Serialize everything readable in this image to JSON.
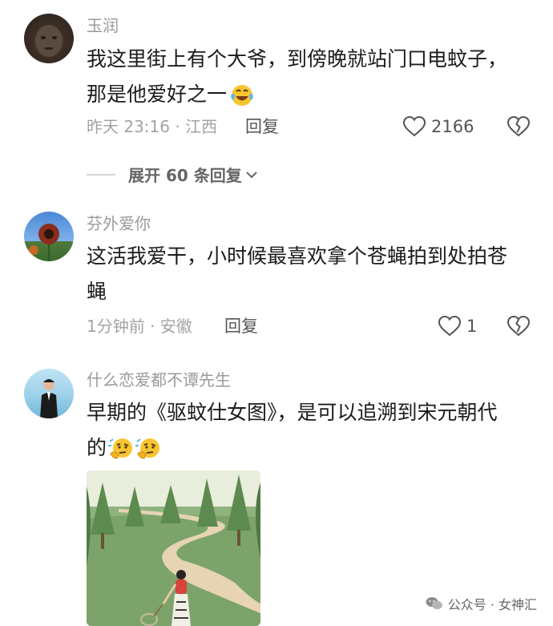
{
  "comments": [
    {
      "username": "玉润",
      "lines": [
        "我这里街上有个大爷，到傍晚就站门口电蚊子，",
        "那是他爱好之一"
      ],
      "time_location": "昨天 23:16 · 江西",
      "reply_label": "回复",
      "likes": "2166",
      "expand_label": "展开 60 条回复"
    },
    {
      "username": "芬外爱你",
      "lines": [
        "这活我爱干，小时候最喜欢拿个苍蝇拍到处拍苍",
        "蝇"
      ],
      "time_location": "1分钟前 · 安徽",
      "reply_label": "回复",
      "likes": "1"
    },
    {
      "username": "什么恋爱都不谭先生",
      "lines": [
        "早期的《驱蚊仕女图》，是可以追溯到宋元朝代",
        "的"
      ]
    }
  ],
  "watermark": {
    "text": "公众号 · 女神汇"
  },
  "icons": {
    "like": "heart-outline-icon",
    "dislike": "broken-heart-icon",
    "expand": "chevron-down-icon",
    "laughing": "laughing-tears-emoji",
    "thinking": "thinking-emoji",
    "wechat": "wechat-icon"
  }
}
